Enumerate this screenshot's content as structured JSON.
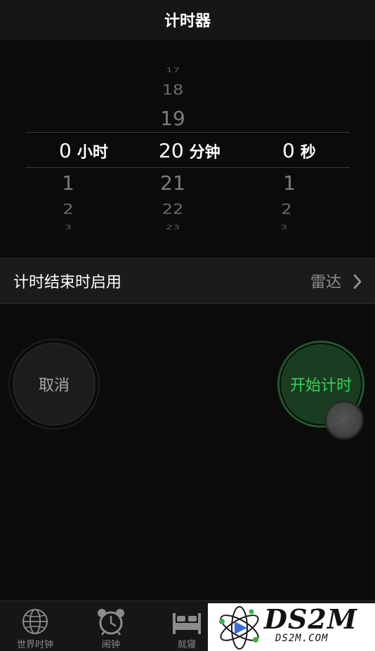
{
  "header": {
    "title": "计时器"
  },
  "picker": {
    "hours": {
      "value": "0",
      "unit": "小时",
      "below": [
        "1",
        "2",
        "3"
      ]
    },
    "minutes": {
      "value": "20",
      "unit": "分钟",
      "above": [
        "17",
        "18",
        "19"
      ],
      "below": [
        "21",
        "22",
        "23"
      ]
    },
    "seconds": {
      "value": "0",
      "unit": "秒",
      "below": [
        "1",
        "2",
        "3"
      ]
    }
  },
  "setting": {
    "label": "计时结束时启用",
    "value": "雷达"
  },
  "actions": {
    "cancel_label": "取消",
    "start_label": "开始计时",
    "start_color": "#39cf5d"
  },
  "tabbar": {
    "items": [
      {
        "label": "世界时钟",
        "icon": "globe-icon"
      },
      {
        "label": "闹钟",
        "icon": "alarm-clock-icon"
      },
      {
        "label": "就寝",
        "icon": "bed-icon"
      }
    ]
  },
  "watermark": {
    "title": "DS2M",
    "subtitle": "DS2M.COM"
  }
}
